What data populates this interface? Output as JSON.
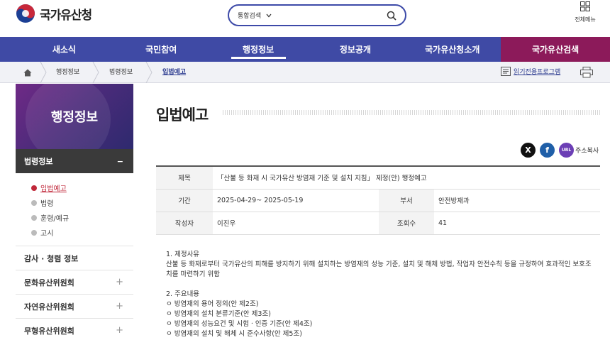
{
  "header": {
    "logo_text": "국가유산청",
    "search_scope": "통합검색",
    "allmenu_label": "전체메뉴"
  },
  "gnb": [
    "새소식",
    "국민참여",
    "행정정보",
    "정보공개",
    "국가유산청소개",
    "국가유산검색"
  ],
  "breadcrumb": [
    "행정정보",
    "법령정보",
    "입법예고"
  ],
  "reader_label": "읽기전용프로그램",
  "sidebar": {
    "title": "행정정보",
    "section": "법령정보",
    "section_toggle": "−",
    "sub_items": [
      "입법예고",
      "법령",
      "훈령/예규",
      "고시"
    ],
    "menus": [
      "감사 · 청렴 정보",
      "문화유산위원회",
      "자연유산위원회",
      "무형유산위원회"
    ],
    "plus": "+"
  },
  "page_title": "입법예고",
  "share": {
    "x": "X",
    "facebook": "f",
    "url": "URL",
    "copy_label": "주소복사"
  },
  "info": {
    "title_label": "제목",
    "title_value": "「산불 등 화재 시 국가유산 방염재 기준 및 설치 지침」 제정(안) 행정예고",
    "period_label": "기간",
    "period_value": "2025-04-29~ 2025-05-19",
    "dept_label": "부서",
    "dept_value": "안전방재과",
    "author_label": "작성자",
    "author_value": "이진우",
    "views_label": "조회수",
    "views_value": "41"
  },
  "body": {
    "s1_title": "1. 제정사유",
    "s1_line1": "산불 등 화재로부터 국가유산의 피해를 방지하기 위해 설치하는 방염재의 성능 기준, 설치 및 해체 방법, 작업자 안전수칙 등을 규정하여 효과적인 보호조",
    "s1_line2": "치를 마련하기 위함",
    "s2_title": "2. 주요내용",
    "s2_items": [
      "ㅇ 방염재의 용어 정의(안 제2조)",
      "ㅇ 방염재의 설치 분류기준(안 제3조)",
      "ㅇ 방염재의 성능요건 및 시험ㆍ인증 기준(안 제4조)",
      "ㅇ 방염재의 설치 및 해체 시 준수사항(안 제5조)"
    ]
  },
  "colors": {
    "gnb": "#3f4aa5",
    "search_tab": "#8c1a5a",
    "accent_red": "#c0283a"
  }
}
